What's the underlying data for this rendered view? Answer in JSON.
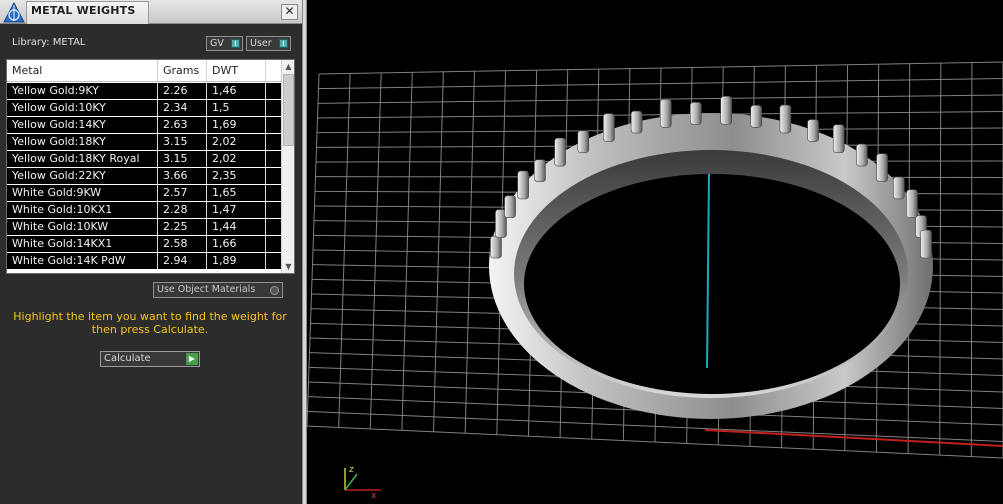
{
  "panel": {
    "title": "METAL WEIGHTS",
    "close_glyph": "✕",
    "library_label": "Library: METAL",
    "toggles": {
      "gv": "GV",
      "user": "User"
    },
    "table": {
      "headers": {
        "metal": "Metal",
        "grams": "Grams",
        "dwt": "DWT"
      },
      "rows": [
        {
          "metal": "Yellow Gold:9KY",
          "grams": "2.26",
          "dwt": "1,46"
        },
        {
          "metal": "Yellow Gold:10KY",
          "grams": "2.34",
          "dwt": "1,5"
        },
        {
          "metal": "Yellow Gold:14KY",
          "grams": "2.63",
          "dwt": "1,69"
        },
        {
          "metal": "Yellow Gold:18KY",
          "grams": "3.15",
          "dwt": "2,02"
        },
        {
          "metal": "Yellow Gold:18KY Royal",
          "grams": "3.15",
          "dwt": "2,02"
        },
        {
          "metal": "Yellow Gold:22KY",
          "grams": "3.66",
          "dwt": "2,35"
        },
        {
          "metal": "White Gold:9KW",
          "grams": "2.57",
          "dwt": "1,65"
        },
        {
          "metal": "White Gold:10KX1",
          "grams": "2.28",
          "dwt": "1,47"
        },
        {
          "metal": "White Gold:10KW",
          "grams": "2.25",
          "dwt": "1,44"
        },
        {
          "metal": "White Gold:14KX1",
          "grams": "2.58",
          "dwt": "1,66"
        },
        {
          "metal": "White Gold:14K PdW",
          "grams": "2.94",
          "dwt": "1,89"
        }
      ]
    },
    "use_object_materials": "Use Object Materials",
    "help_text": "Highlight the item you want to find the weight for then press Calculate.",
    "calculate_label": "Calculate",
    "icons": {
      "app": "rhino-app-icon",
      "calc_arrow": "play-arrow-icon"
    }
  },
  "viewport": {
    "background": "#000000",
    "grid_color": "#808080",
    "axis_y_color": "#1fa8b8",
    "axis_x_color": "#c0201a",
    "ring_color": "#bdbdbd"
  }
}
